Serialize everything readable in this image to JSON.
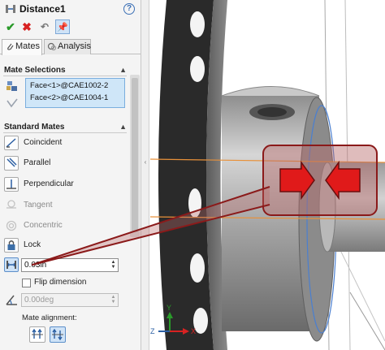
{
  "title": "Distance1",
  "help": "?",
  "tabs": {
    "mates": "Mates",
    "analysis": "Analysis"
  },
  "mate_selections": {
    "header": "Mate Selections",
    "items": [
      "Face<1>@CAE1002-2",
      "Face<2>@CAE1004-1"
    ]
  },
  "standard_mates": {
    "header": "Standard Mates",
    "items": [
      {
        "label": "Coincident",
        "icon": "coincident-icon",
        "enabled": true
      },
      {
        "label": "Parallel",
        "icon": "parallel-icon",
        "enabled": true
      },
      {
        "label": "Perpendicular",
        "icon": "perpendicular-icon",
        "enabled": true
      },
      {
        "label": "Tangent",
        "icon": "tangent-icon",
        "enabled": false
      },
      {
        "label": "Concentric",
        "icon": "concentric-icon",
        "enabled": false
      },
      {
        "label": "Lock",
        "icon": "lock-icon",
        "enabled": true
      }
    ]
  },
  "distance": {
    "value": "0.03in",
    "icon": "distance-icon"
  },
  "flip_dimension": {
    "label": "Flip dimension",
    "checked": false
  },
  "angle": {
    "value": "0.00deg",
    "enabled": false
  },
  "mate_alignment": {
    "label": "Mate alignment:",
    "selected": "anti-aligned"
  },
  "triad": {
    "x": "X",
    "y": "Y",
    "z": "Z"
  },
  "colors": {
    "accent": "#3a6fb5",
    "selection_fill": "#cfe6f8",
    "callout_red": "#8b1a1a",
    "arrow_red": "#e01a1a",
    "ok_green": "#2a9a2a",
    "cancel_red": "#d82222",
    "edge_orange": "#e8913a"
  }
}
